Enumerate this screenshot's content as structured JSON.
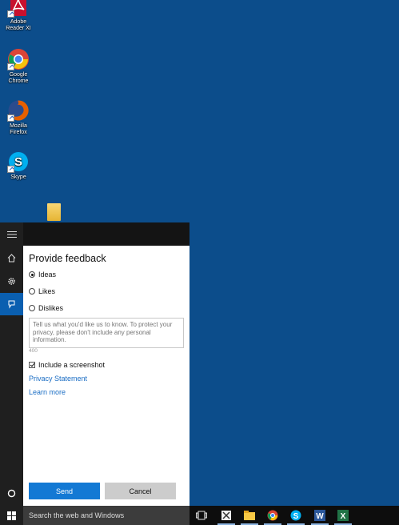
{
  "desktop": {
    "icons": [
      {
        "label_line1": "Adobe",
        "label_line2": "Reader XI",
        "icon": "adobe-reader-icon",
        "color": "#c8102e"
      },
      {
        "label_line1": "Google",
        "label_line2": "Chrome",
        "icon": "chrome-icon",
        "color": "#db4437"
      },
      {
        "label_line1": "Mozilla",
        "label_line2": "Firefox",
        "icon": "firefox-icon",
        "color": "#e66000"
      },
      {
        "label_line1": "Skype",
        "label_line2": "",
        "icon": "skype-icon",
        "color": "#00aff0"
      }
    ]
  },
  "feedback": {
    "title": "Provide feedback",
    "options": [
      {
        "label": "Ideas",
        "checked": true
      },
      {
        "label": "Likes",
        "checked": false
      },
      {
        "label": "Dislikes",
        "checked": false
      }
    ],
    "textbox_placeholder": "Tell us what you'd like us to know. To protect your privacy, please don't include any personal information.",
    "char_count": "400",
    "screenshot_label": "Include a screenshot",
    "screenshot_checked": true,
    "privacy_link": "Privacy Statement",
    "learn_more_link": "Learn more",
    "send_label": "Send",
    "cancel_label": "Cancel"
  },
  "taskbar": {
    "search_text": "Search the web and Windows",
    "apps": [
      "task-view-icon",
      "tools-icon",
      "file-explorer-icon",
      "chrome-icon",
      "skype-icon",
      "word-icon",
      "excel-icon"
    ]
  },
  "colors": {
    "desktop": "#0c4d8b",
    "accent": "#1379d4",
    "link": "#1a6dc4"
  }
}
